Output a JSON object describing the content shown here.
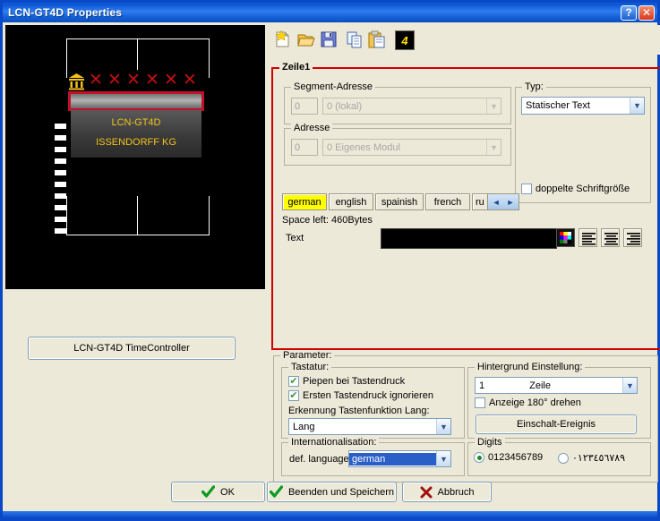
{
  "window": {
    "title": "LCN-GT4D Properties",
    "help_button": "?",
    "close_button": "✕"
  },
  "toolbar": {
    "icons": [
      {
        "name": "new-document-icon",
        "label": "New"
      },
      {
        "name": "open-folder-icon",
        "label": "Open"
      },
      {
        "name": "save-icon",
        "label": "Save"
      },
      {
        "name": "copy-icon",
        "label": "Copy"
      },
      {
        "name": "paste-icon",
        "label": "Paste"
      },
      {
        "name": "display-4-icon",
        "label": "4"
      }
    ],
    "display_badge": "4"
  },
  "preview": {
    "line_1": "LCN-GT4D",
    "line_2": "ISSENDORFF KG",
    "x_marks": "X X X X X X",
    "time_controller_button": "LCN-GT4D TimeController"
  },
  "zeile": {
    "group_title": "Zeile1",
    "segment_address": {
      "group_title": "Segment-Adresse",
      "number_value": "0",
      "combo_value": "0 (lokal)"
    },
    "address": {
      "group_title": "Adresse",
      "number_value": "0",
      "combo_value": "0   Eigenes Modul"
    },
    "type": {
      "group_title": "Typ:",
      "value": "Statischer Text",
      "double_font_label": "doppelte Schriftgröße",
      "double_font_checked": false
    },
    "languages": {
      "tabs": [
        "german",
        "english",
        "spainish",
        "french",
        "ru"
      ],
      "selected": "german",
      "scroll_left": "◄",
      "scroll_right": "►"
    },
    "space_left": "Space left: 460Bytes",
    "text_label": "Text",
    "text_value": "",
    "align_buttons": [
      "align-left",
      "align-center",
      "align-right"
    ]
  },
  "parameter": {
    "group_title": "Parameter:",
    "keyboard": {
      "group_title": "Tastatur:",
      "beep_label": "Piepen bei Tastendruck",
      "beep_checked": true,
      "ignore_first_label": "Ersten Tastendruck ignorieren",
      "ignore_first_checked": true,
      "long_detect_label": "Erkennung Tastenfunktion Lang:",
      "long_detect_value": "Lang"
    },
    "internationalisation": {
      "group_title": "Internationalisation:",
      "default_language_label": "def. language",
      "default_language_value": "german"
    },
    "background": {
      "group_title": "Hintergrund Einstellung:",
      "lines_number": "1",
      "lines_label": "Zeile",
      "rotate_label": "Anzeige 180° drehen",
      "rotate_checked": false,
      "power_on_event_button": "Einschalt-Ereignis"
    },
    "digits": {
      "group_title": "Digits",
      "latin_label": "0123456789",
      "latin_selected": true,
      "arabic_label": "٠١٢٣٤٥٦٧٨٩",
      "arabic_selected": false
    }
  },
  "footer": {
    "ok_button": "OK",
    "save_exit_button": "Beenden und Speichern",
    "cancel_button": "Abbruch"
  },
  "colors": {
    "title_blue": "#0a55d0",
    "accent_red": "#d00000",
    "display_yellow": "#f2c21a",
    "tab_highlight": "#ffff00",
    "face": "#ece9d8"
  }
}
